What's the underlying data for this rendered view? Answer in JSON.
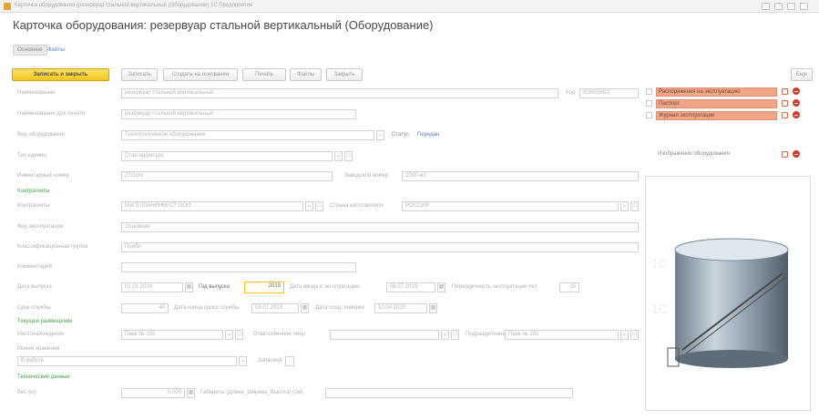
{
  "window": {
    "title": "Карточка оборудования (резервуар стальной вертикальный (Оборудование) 1С:Предприятие"
  },
  "form": {
    "title": "Карточка оборудования: резервуар стальной вертикальный (Оборудование)"
  },
  "nav": {
    "tabs": [
      "Основное",
      "Файлы"
    ]
  },
  "toolbar": {
    "save_close": "Записать и закрыть",
    "save": "Записать",
    "create_based": "Создать на основании",
    "print": "Печать",
    "files": "Файлы",
    "close": "Закрыть",
    "more": "Еще"
  },
  "fields": {
    "name_label": "Наименование",
    "name_value": "резервуар стальной вертикальный",
    "code_label": "Код",
    "code_value": "000000002",
    "print_name_label": "Наименование для печати",
    "print_name_value": "резервуар стальной вертикальный",
    "equip_type_label": "Вид оборудования",
    "equip_type_value": "Технологическое оборудование",
    "status_label": "Статус",
    "status_value": "Передан",
    "type_label": "Тип единиц",
    "type_value": "Стар ед/ресурс",
    "inv_label": "Инвентарный номер",
    "inv_value": "27/1хxx",
    "serial_label": "Заводской номер",
    "serial_value": "2000-м1",
    "contractor_section": "Контрагенты",
    "contractor_label": "Контрагенты",
    "contractor_value": "МАГЕЛЛАНИНВЕСТ ООО",
    "country_label": "Страна изготовителя",
    "country_value": "РОССИЯ",
    "usage_label": "Вид эксплуатации",
    "usage_value": "Основная",
    "group_label": "Классификационная группа",
    "group_value": "Прибл",
    "comment_label": "Комментарий",
    "release_label": "Дата выпуска",
    "release_value": "01.01.2019",
    "release_year_label": "Год выпуска",
    "release_year_value": "2019",
    "commission_label": "Дата ввода в эксплуатацию",
    "commission_value": "08.07.2019",
    "period_label": "Периодичность эксплуатации лет",
    "period_value": "15",
    "service_label": "Срок службы",
    "service_value": "40",
    "service_end_label": "Дата конца срока службы",
    "service_end_value": "08.07.2023",
    "next_check_label": "Дата след. поверки",
    "next_check_value": "10.04.2020",
    "location_section": "Текущее размещение",
    "location_label": "Местонахождение",
    "location_value": "Парк № 102",
    "responsible_label": "Ответственное лицо",
    "dept_label": "Подразделение",
    "dept_value": "Парк № 102",
    "state_label": "Режим хранения",
    "state_value": "В работе",
    "spare_label": "Запасной",
    "tech_section": "Технические данные",
    "weight_label": "Вес (кг)",
    "weight_value": "0,000",
    "dims_label": "Габариты (Длина_Ширина_Высота) (см)"
  },
  "right_panel": {
    "links": [
      "Распоряжения на эксплуатацию",
      "Паспорт",
      "Журнал эксплуатации"
    ],
    "image_title": "Изображение оборудования"
  },
  "colors": {
    "accent": "#f2c41c",
    "section_green": "#47a04c",
    "highlight": "#f0a586",
    "delete_red": "#d83a2a",
    "link_blue": "#5a86c9"
  }
}
